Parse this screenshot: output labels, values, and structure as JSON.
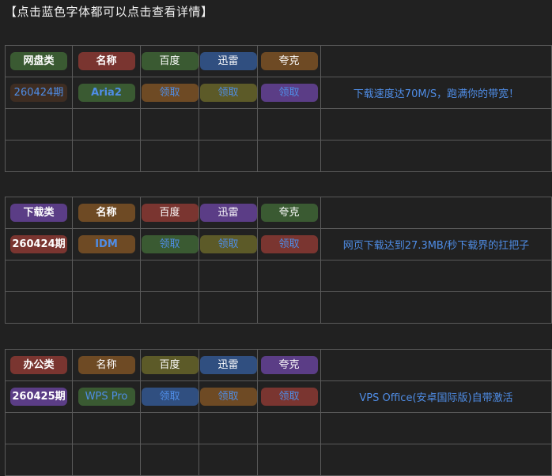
{
  "heading": "【点击蓝色字体都可以点击查看详情】",
  "sections": [
    {
      "category": "网盘类",
      "headers": [
        "名称",
        "百度",
        "迅雷",
        "夸克"
      ],
      "issue": "260424期",
      "name": "Aria2",
      "links": [
        "领取",
        "领取",
        "领取"
      ],
      "description": "下载速度达70M/S，跑满你的带宽！"
    },
    {
      "category": "下载类",
      "headers": [
        "名称",
        "百度",
        "迅雷",
        "夸克"
      ],
      "issue": "260424期",
      "name": "IDM",
      "links": [
        "领取",
        "领取",
        "领取"
      ],
      "description": "网页下载达到27.3MB/秒下载界的扛把子"
    },
    {
      "category": "办公类",
      "headers": [
        "名称",
        "百度",
        "迅雷",
        "夸克"
      ],
      "issue": "260425期",
      "name": "WPS Pro",
      "links": [
        "领取",
        "领取",
        "领取"
      ],
      "description": "VPS Office(安卓国际版)自带激活"
    }
  ],
  "colors": {
    "background": "#212121",
    "link_blue": "#4f8de6",
    "green": "#3a5a32",
    "red": "#7a3530",
    "brown": "#6e4a24",
    "blue": "#304f80",
    "purple": "#5b3d86",
    "olive": "#5c5a28"
  }
}
